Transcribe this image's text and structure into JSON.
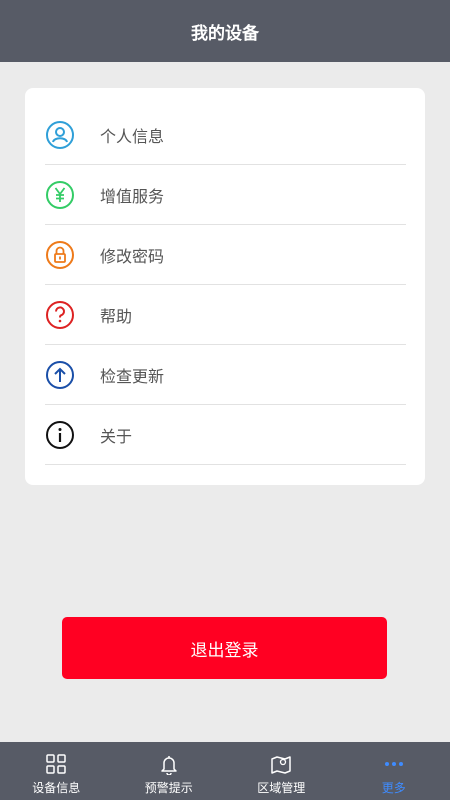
{
  "header": {
    "title": "我的设备"
  },
  "menu": [
    {
      "label": "个人信息",
      "icon": "user-icon",
      "color": "#2f9fd8"
    },
    {
      "label": "增值服务",
      "icon": "yen-icon",
      "color": "#33cc66"
    },
    {
      "label": "修改密码",
      "icon": "lock-icon",
      "color": "#ee7a1a"
    },
    {
      "label": "帮助",
      "icon": "question-icon",
      "color": "#dd2222"
    },
    {
      "label": "检查更新",
      "icon": "arrow-up-icon",
      "color": "#1a4fa8"
    },
    {
      "label": "关于",
      "icon": "info-icon",
      "color": "#111111"
    }
  ],
  "logout": {
    "label": "退出登录",
    "color": "#ff0022"
  },
  "tabs": [
    {
      "label": "设备信息",
      "icon": "grid-icon"
    },
    {
      "label": "预警提示",
      "icon": "bell-icon"
    },
    {
      "label": "区域管理",
      "icon": "map-icon"
    },
    {
      "label": "更多",
      "icon": "more-icon",
      "active": true,
      "color": "#3f8cff"
    }
  ]
}
